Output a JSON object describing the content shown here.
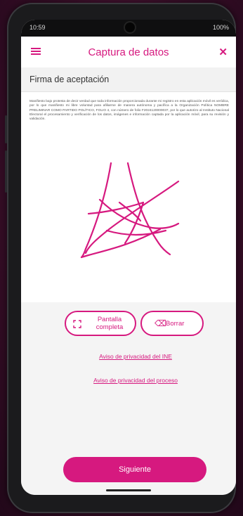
{
  "status_bar": {
    "time": "10:59",
    "battery": "100%"
  },
  "app_bar": {
    "title": "Captura de datos"
  },
  "section": {
    "title": "Firma de aceptación"
  },
  "disclaimer": "Manifiesto bajo protesta de decir verdad que toda información proporcionada durante mi registro en esta aplicación móvil es verídica, por lo que manifiesto mi libre voluntad para afiliarme de manera autónoma y pacífica a la Organización Política NOMBRE PRELIMINAR COMO PARTIDO POLÍTICO, FOLIO 4, con número de folio F2024120000037, por lo que autorizo al Instituto Nacional Electoral el procesamiento y verificación de los datos, imágenes e información captada por la aplicación móvil, para su revisión y validación.",
  "buttons": {
    "fullscreen_line1": "Pantalla",
    "fullscreen_line2": "completa",
    "clear": "Borrar",
    "next": "Siguiente"
  },
  "links": {
    "ine_privacy": "Aviso de privacidad del INE",
    "process_privacy": "Aviso de privacidad del proceso"
  },
  "colors": {
    "accent": "#d6197f",
    "signature": "#d6197f"
  }
}
